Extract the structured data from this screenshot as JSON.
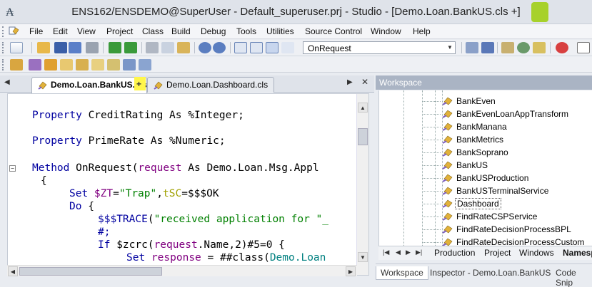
{
  "window": {
    "title": "ENS162/ENSDEMO@SuperUser - Default_superuser.prj - Studio - [Demo.Loan.BankUS.cls +]"
  },
  "menu": [
    "File",
    "Edit",
    "View",
    "Project",
    "Class",
    "Build",
    "Debug",
    "Tools",
    "Utilities",
    "Source Control",
    "Window",
    "Help"
  ],
  "toolbar": {
    "method_combo_value": "OnRequest"
  },
  "editor_tabs": [
    {
      "label": "Demo.Loan.BankUS.cls",
      "modified_marker": "+",
      "active": true
    },
    {
      "label": "Demo.Loan.Dashboard.cls",
      "active": false
    }
  ],
  "code": {
    "line1": {
      "kw": "Property",
      "rest": " CreditRating As %Integer;"
    },
    "line2": {
      "kw": "Property",
      "rest": " PrimeRate As %Numeric;"
    },
    "line3": {
      "kw": "Method",
      "name": " OnRequest(",
      "arg": "request",
      "rest": " As Demo.Loan.Msg.Appl"
    },
    "line4": {
      "text": "{"
    },
    "line5": {
      "kw": "Set ",
      "var": "$ZT",
      "eq": "=",
      "str": "\"Trap\"",
      "comma": ",",
      "var2": "tSC",
      "rest": "=$$$OK"
    },
    "line6": {
      "kw": "Do",
      "rest": " {"
    },
    "line7": {
      "mac": "$$$TRACE",
      "rest": "(",
      "str": "\"received application for \"_"
    },
    "line8": {
      "text": "#;"
    },
    "line9": {
      "kw": "If",
      "rest": " $zcrc(",
      "var": "request",
      "rest2": ".Name,2)#5=0 {"
    },
    "line10": {
      "kw": "Set",
      "rest": " ",
      "var": "response",
      "eq": " = ##class(",
      "cls": "Demo.Loan"
    }
  },
  "workspace": {
    "header": "Workspace",
    "tree_items": [
      "BankEven",
      "BankEvenLoanAppTransform",
      "BankManana",
      "BankMetrics",
      "BankSoprano",
      "BankUS",
      "BankUSProduction",
      "BankUSTerminalService",
      "Dashboard",
      "FindRateCSPService",
      "FindRateDecisionProcessBPL",
      "FindRateDecisionProcessCustom"
    ],
    "selected_item": "Dashboard",
    "tabs": [
      "Production",
      "Project",
      "Windows",
      "Namesp"
    ],
    "bottom_tabs": [
      "Workspace",
      "Inspector - Demo.Loan.BankUS",
      "Code Snip"
    ]
  },
  "colors": {
    "highlight_green": "#a7d12b",
    "highlight_yellow": "#fff64a",
    "keyword": "#0000a0",
    "string": "#008000",
    "variable": "#800080"
  }
}
